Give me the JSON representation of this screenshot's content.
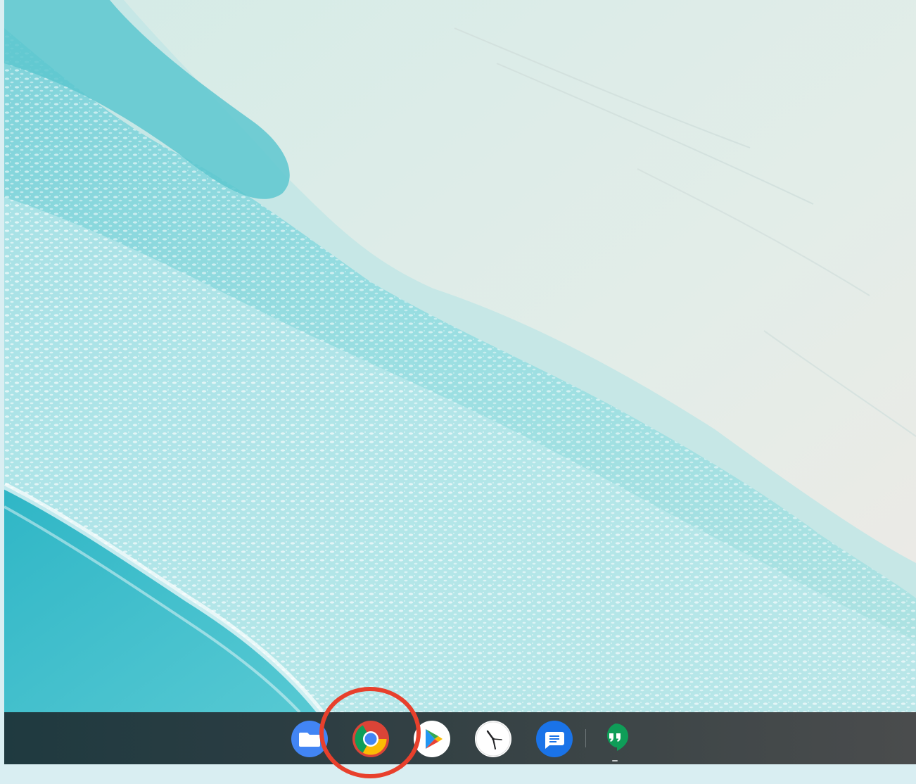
{
  "wallpaper": {
    "name": "beach-aerial-wallpaper",
    "colors": {
      "sand": "#e6eeea",
      "shallow": "#c5e6e6",
      "foam": "#eaf7f8",
      "surf": "#8fd6dc",
      "deep": "#3fc0cd"
    }
  },
  "shelf": {
    "apps": [
      {
        "id": "files",
        "icon": "folder-icon",
        "color": "#4285f4"
      },
      {
        "id": "chrome",
        "icon": "chrome-icon",
        "color": "#db4437",
        "highlighted": true
      },
      {
        "id": "play-store",
        "icon": "play-store-icon",
        "color": "#34a853"
      },
      {
        "id": "clock",
        "icon": "clock-icon",
        "color": "#ffffff"
      },
      {
        "id": "messages",
        "icon": "messages-icon",
        "color": "#1a73e8"
      },
      {
        "id": "hangouts",
        "icon": "hangouts-icon",
        "color": "#0f9d58",
        "running": true
      }
    ]
  },
  "annotation": {
    "ring_color": "#e8402c",
    "target": "chrome"
  }
}
